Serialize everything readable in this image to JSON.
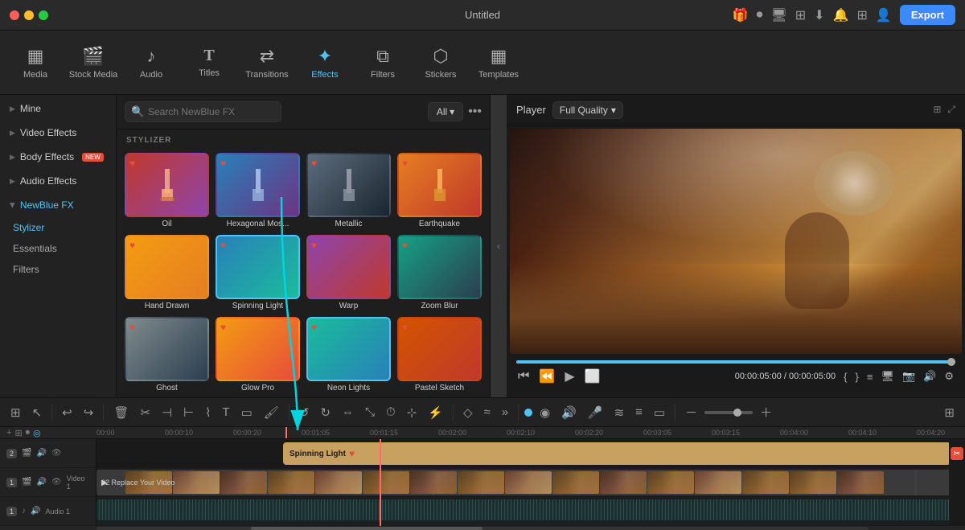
{
  "app": {
    "title": "Untitled",
    "export_label": "Export"
  },
  "toolbar": {
    "items": [
      {
        "id": "media",
        "label": "Media",
        "icon": "⬛"
      },
      {
        "id": "stock-media",
        "label": "Stock Media",
        "icon": "🎬"
      },
      {
        "id": "audio",
        "label": "Audio",
        "icon": "🎵"
      },
      {
        "id": "titles",
        "label": "Titles",
        "icon": "T"
      },
      {
        "id": "transitions",
        "label": "Transitions",
        "icon": "◇"
      },
      {
        "id": "effects",
        "label": "Effects",
        "icon": "✦"
      },
      {
        "id": "filters",
        "label": "Filters",
        "icon": "≋"
      },
      {
        "id": "stickers",
        "label": "Stickers",
        "icon": "⬡"
      },
      {
        "id": "templates",
        "label": "Templates",
        "icon": "▦"
      }
    ]
  },
  "left_panel": {
    "items": [
      {
        "id": "mine",
        "label": "Mine",
        "has_arrow": true
      },
      {
        "id": "video-effects",
        "label": "Video Effects",
        "has_arrow": true
      },
      {
        "id": "body-effects",
        "label": "Body Effects",
        "has_arrow": true,
        "badge": "NEW"
      },
      {
        "id": "audio-effects",
        "label": "Audio Effects",
        "has_arrow": true
      },
      {
        "id": "newblue-fx",
        "label": "NewBlue FX",
        "has_arrow": true,
        "active": true
      }
    ],
    "sub_items": [
      {
        "id": "stylizer",
        "label": "Stylizer",
        "active": true
      },
      {
        "id": "essentials",
        "label": "Essentials"
      },
      {
        "id": "filters",
        "label": "Filters"
      }
    ]
  },
  "effects_panel": {
    "search_placeholder": "Search NewBlue FX",
    "all_label": "All",
    "section_label": "STYLIZER",
    "effects": [
      {
        "id": "oil",
        "name": "Oil",
        "theme": "oil",
        "favorited": true
      },
      {
        "id": "hexagonal-mos",
        "name": "Hexagonal Mos...",
        "theme": "hex",
        "favorited": true
      },
      {
        "id": "metallic",
        "name": "Metallic",
        "theme": "metallic",
        "favorited": true
      },
      {
        "id": "earthquake",
        "name": "Earthquake",
        "theme": "earthquake",
        "favorited": true
      },
      {
        "id": "hand-drawn",
        "name": "Hand Drawn",
        "theme": "hand",
        "favorited": true
      },
      {
        "id": "spinning-light",
        "name": "Spinning Light",
        "theme": "spinning",
        "favorited": true,
        "selected": true
      },
      {
        "id": "warp",
        "name": "Warp",
        "theme": "warp",
        "favorited": true
      },
      {
        "id": "zoom-blur",
        "name": "Zoom Blur",
        "theme": "zoom",
        "favorited": true
      },
      {
        "id": "ghost",
        "name": "Ghost",
        "theme": "ghost",
        "favorited": true
      },
      {
        "id": "glow-pro",
        "name": "Glow Pro",
        "theme": "glow",
        "favorited": true
      },
      {
        "id": "neon-lights",
        "name": "Neon Lights",
        "theme": "neon",
        "favorited": true,
        "highlighted": true
      },
      {
        "id": "pastel-sketch",
        "name": "Pastel Sketch",
        "theme": "pastel",
        "favorited": true
      }
    ]
  },
  "player": {
    "label": "Player",
    "quality": "Full Quality",
    "current_time": "00:00:05:00",
    "total_time": "00:00:05:00"
  },
  "timeline": {
    "ruler_marks": [
      "00:00",
      "00:00:10",
      "00:00:20",
      "00:01:05",
      "00:01:15",
      "00:02:00",
      "00:02:10",
      "00:02:20",
      "00:03:05",
      "00:03:15",
      "00:04:00",
      "00:04:10",
      "00:04:20"
    ],
    "tracks": [
      {
        "id": "fx-2",
        "type": "fx",
        "label": "2",
        "icons": [
          "film",
          "speaker",
          "eye"
        ]
      },
      {
        "id": "video-1",
        "type": "video",
        "label": "Video 1",
        "icons": [
          "film",
          "eye"
        ]
      },
      {
        "id": "audio-1",
        "type": "audio",
        "label": "Audio 1",
        "icons": [
          "speaker"
        ]
      }
    ],
    "fx_clip_label": "Spinning Light",
    "video_clip_label": "02 Replace Your Video"
  }
}
